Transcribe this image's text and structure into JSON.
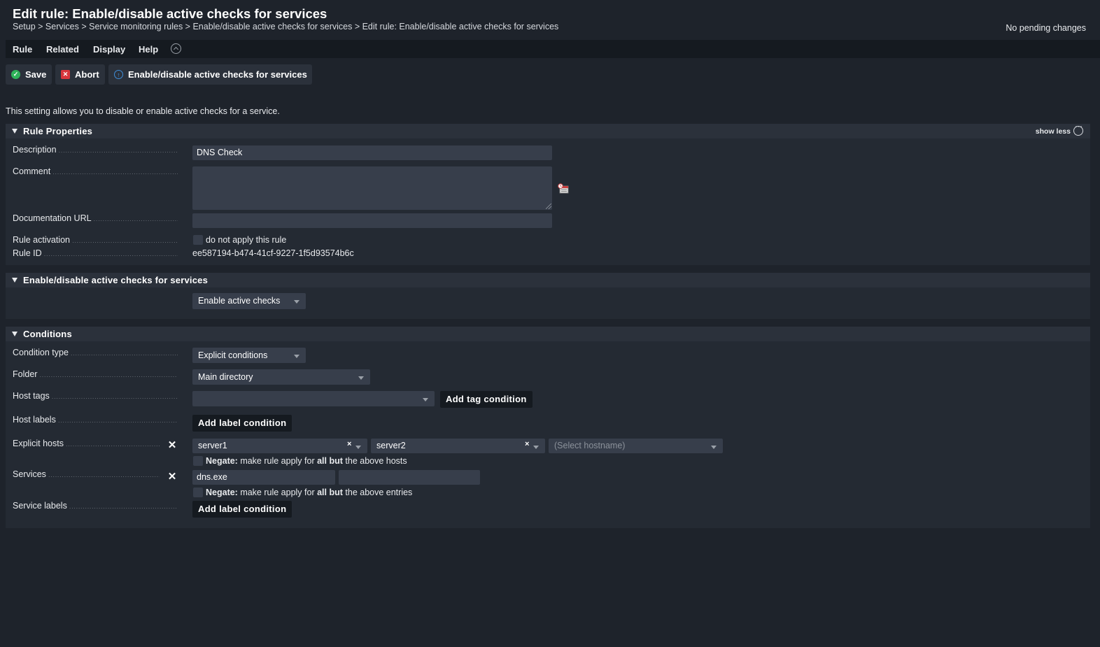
{
  "header": {
    "title": "Edit rule: Enable/disable active checks for services",
    "breadcrumb": [
      "Setup",
      "Services",
      "Service monitoring rules",
      "Enable/disable active checks for services",
      "Edit rule: Enable/disable active checks for services"
    ],
    "pending": "No pending changes"
  },
  "menu": {
    "items": [
      "Rule",
      "Related",
      "Display",
      "Help"
    ]
  },
  "toolbar": {
    "save_label": "Save",
    "abort_label": "Abort",
    "ruleset_label": "Enable/disable active checks for services"
  },
  "intro": "This setting allows you to disable or enable active checks for a service.",
  "rule_properties": {
    "title": "Rule Properties",
    "show_less": "show less",
    "description_label": "Description",
    "description_value": "DNS Check",
    "comment_label": "Comment",
    "comment_value": "",
    "doc_url_label": "Documentation URL",
    "doc_url_value": "",
    "activation_label": "Rule activation",
    "activation_text": "do not apply this rule",
    "rule_id_label": "Rule ID",
    "rule_id_value": "ee587194-b474-41cf-9227-1f5d93574b6c"
  },
  "value_section": {
    "title": "Enable/disable active checks for services",
    "selected": "Enable active checks"
  },
  "conditions": {
    "title": "Conditions",
    "condition_type_label": "Condition type",
    "condition_type_value": "Explicit conditions",
    "folder_label": "Folder",
    "folder_value": "Main directory",
    "host_tags_label": "Host tags",
    "host_tags_value": "",
    "add_tag_condition": "Add tag condition",
    "host_labels_label": "Host labels",
    "add_label_condition": "Add label condition",
    "explicit_hosts_label": "Explicit hosts",
    "hosts": [
      "server1",
      "server2"
    ],
    "host_placeholder": "(Select hostname)",
    "negate_bold": "Negate:",
    "negate_pre": " make rule apply for ",
    "negate_all": "all",
    "negate_but": "but",
    "negate_hosts_tail": " the above hosts",
    "services_label": "Services",
    "services": [
      "dns.exe",
      ""
    ],
    "negate_entries_tail": " the above entries",
    "service_labels_label": "Service labels",
    "add_service_label_condition": "Add label condition"
  },
  "colors": {
    "background": "#1e232b",
    "panel": "#242a33",
    "header_bar": "#2b313b",
    "input": "#373e4b",
    "save_green": "#2fb35a",
    "abort_red": "#d8353b",
    "info_blue": "#3f8ed9"
  },
  "icons": [
    "check-circle-icon",
    "abort-icon",
    "info-icon",
    "collapse-up-icon",
    "more-icon",
    "calendar-icon",
    "close-icon",
    "chevron-down-icon",
    "triangle-down-icon"
  ]
}
